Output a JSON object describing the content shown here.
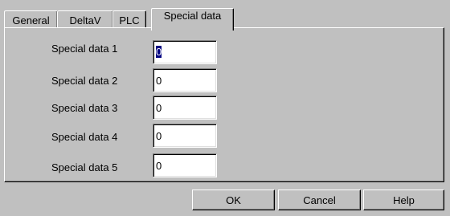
{
  "tabs": [
    {
      "label": "General"
    },
    {
      "label": "DeltaV"
    },
    {
      "label": "PLC"
    },
    {
      "label": "Special data",
      "active": true
    }
  ],
  "fields": [
    {
      "label": "Special data 1",
      "value": "0",
      "selected": true
    },
    {
      "label": "Special data 2",
      "value": "0"
    },
    {
      "label": "Special data 3",
      "value": "0"
    },
    {
      "label": "Special data 4",
      "value": "0"
    },
    {
      "label": "Special data 5",
      "value": "0"
    }
  ],
  "buttons": {
    "ok_label": "OK",
    "cancel_label": "Cancel",
    "help_label": "Help"
  },
  "colors": {
    "dialog_face": "#c0c0c0",
    "selection": "#000080"
  }
}
